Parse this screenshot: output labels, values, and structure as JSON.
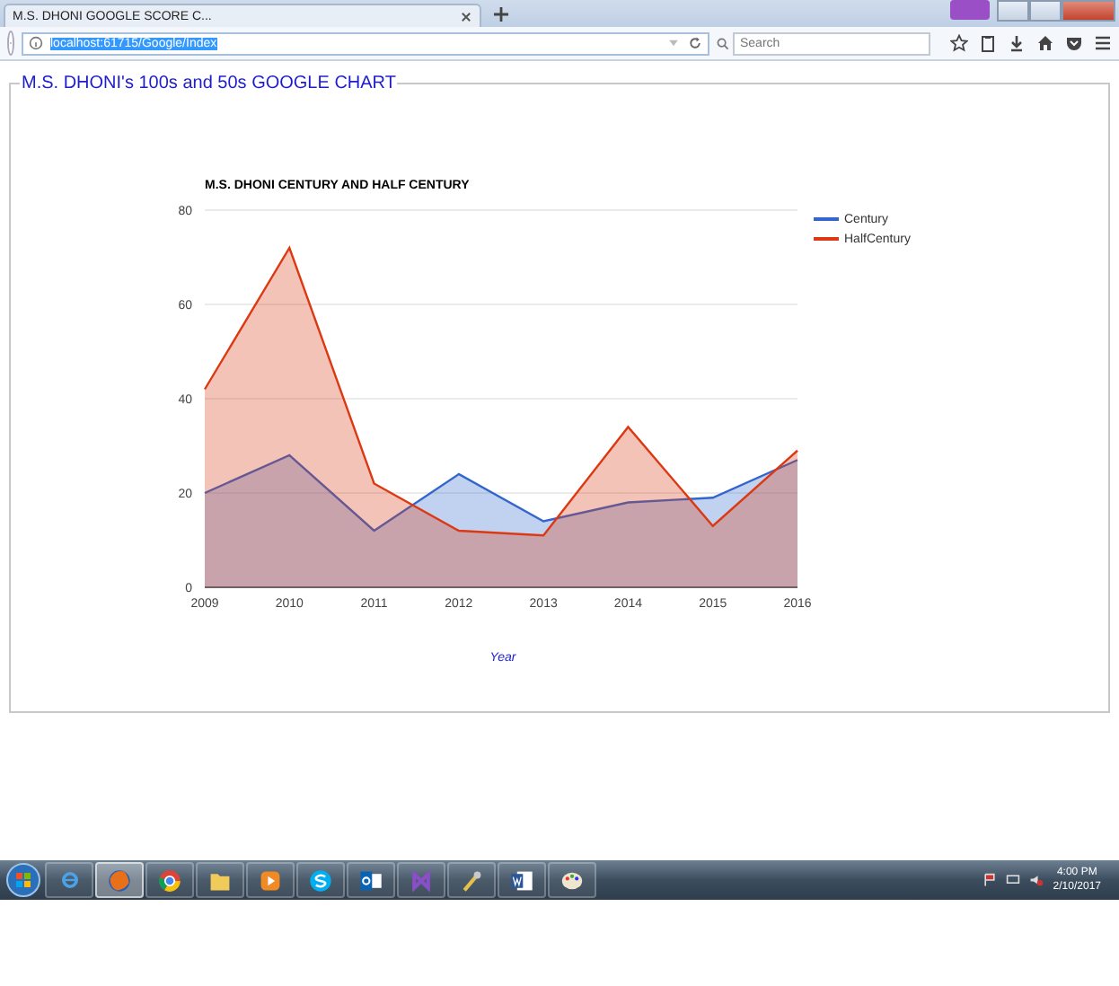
{
  "browser": {
    "tabs": [
      {
        "title": "M.S. DHONI GOOGLE SCORE C...",
        "selected": true
      }
    ],
    "address": "localhost:61715/Google/Index",
    "search": {
      "placeholder": "Search"
    }
  },
  "page": {
    "legend": "M.S. DHONI's 100s and 50s GOOGLE CHART",
    "chart_data": {
      "type": "area",
      "grid": true,
      "legend": true,
      "title": "M.S. DHONI CENTURY AND HALF CENTURY",
      "xlabel": "Year",
      "categories": [
        "2009",
        "2010",
        "2011",
        "2012",
        "2013",
        "2014",
        "2015",
        "2016"
      ],
      "ylim": [
        0,
        80
      ],
      "yticks": [
        0,
        20,
        40,
        60,
        80
      ],
      "series": [
        {
          "name": "Century",
          "color": "#3366cc",
          "values": [
            20,
            28,
            12,
            24,
            14,
            18,
            19,
            27
          ]
        },
        {
          "name": "HalfCentury",
          "color": "#dc3912",
          "values": [
            42,
            72,
            22,
            12,
            11,
            34,
            13,
            29
          ]
        }
      ]
    }
  },
  "taskbar": {
    "apps": [
      {
        "kind": "ie",
        "selected": false
      },
      {
        "kind": "firefox",
        "selected": true
      },
      {
        "kind": "chrome",
        "selected": false
      },
      {
        "kind": "folder",
        "selected": false
      },
      {
        "kind": "media",
        "selected": false
      },
      {
        "kind": "skype",
        "selected": false
      },
      {
        "kind": "outlook",
        "selected": false
      },
      {
        "kind": "studio",
        "selected": false
      },
      {
        "kind": "tools",
        "selected": false
      },
      {
        "kind": "word",
        "selected": false
      },
      {
        "kind": "paint",
        "selected": false
      }
    ],
    "time": "4:00 PM",
    "date": "2/10/2017"
  }
}
